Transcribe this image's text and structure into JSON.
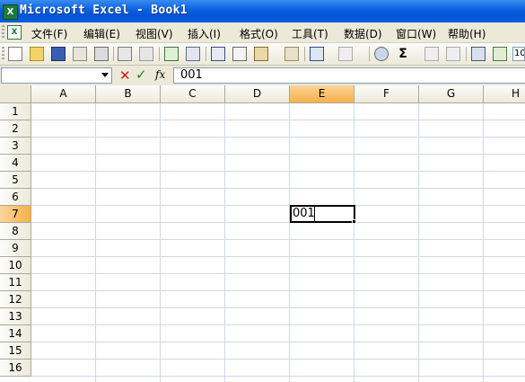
{
  "window": {
    "title": "Microsoft Excel - Book1",
    "logo_glyph": "X"
  },
  "menu": {
    "doc_icon_glyph": "X",
    "items": [
      {
        "label": "文件(F)"
      },
      {
        "label": "编辑(E)"
      },
      {
        "label": "视图(V)"
      },
      {
        "label": "插入(I)"
      },
      {
        "label": "格式(O)"
      },
      {
        "label": "工具(T)"
      },
      {
        "label": "数据(D)"
      },
      {
        "label": "窗口(W)"
      },
      {
        "label": "帮助(H)"
      }
    ]
  },
  "toolbar": {
    "buttons": [
      "new-icon",
      "open-icon",
      "save-icon",
      "permission-icon",
      "print-icon",
      "print-preview-icon",
      "spelling-icon",
      "research-icon",
      "cut-icon",
      "copy-icon",
      "paste-icon",
      "format-painter-icon",
      "undo-icon",
      "redo-icon",
      "hyperlink-icon",
      "autosum-icon",
      "sort-ascending-icon",
      "sort-descending-icon",
      "chart-wizard-icon",
      "drawing-icon",
      "zoom-box"
    ],
    "autosum_glyph": "Σ",
    "zoom_value": "10"
  },
  "formula_bar": {
    "name_box": "",
    "cancel_glyph": "✕",
    "enter_glyph": "✓",
    "fx_label": "fx",
    "content": "001"
  },
  "sheet": {
    "columns": [
      "A",
      "B",
      "C",
      "D",
      "E",
      "F",
      "G",
      "H"
    ],
    "rows": [
      "1",
      "2",
      "3",
      "4",
      "5",
      "6",
      "7",
      "8",
      "9",
      "10",
      "11",
      "12",
      "13",
      "14",
      "15",
      "16"
    ],
    "active_column": "E",
    "active_row": "7",
    "active_cell": {
      "ref": "E7",
      "value": "001"
    }
  },
  "colors": {
    "title_bar": "#0a5fe0",
    "active_header": "#f8b048",
    "gridline": "#d0d7e5"
  }
}
